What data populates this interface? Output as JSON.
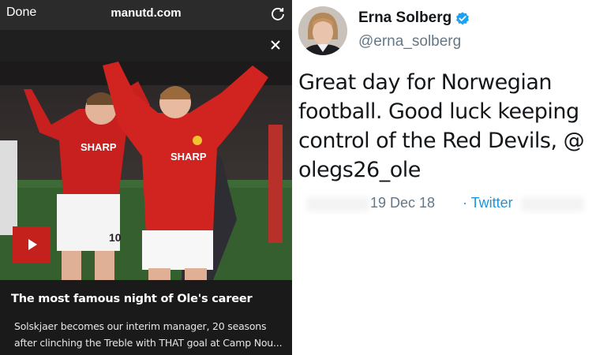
{
  "browser": {
    "done_label": "Done",
    "url": "manutd.com",
    "reload_icon": "reload-icon",
    "close_icon": "close-icon"
  },
  "article": {
    "play_icon": "play-icon",
    "title": "The most famous night of Ole's career",
    "summary_lines": [
      "Solskjaer becomes our interim manager, 20 seasons",
      "after clinching the Treble with THAT goal at Camp Nou..."
    ]
  },
  "tweet": {
    "display_name": "Erna Solberg",
    "verified_icon": "verified-badge-icon",
    "handle": "@erna_solberg",
    "text_lines": [
      "Great day for Norwegian",
      "football. Good luck keeping",
      "control of the Red Devils, @",
      "olegs26_ole"
    ],
    "date": "19 Dec 18",
    "source": "· Twitter"
  },
  "colors": {
    "accent_red": "#c4201c",
    "twitter_blue": "#1b95e0",
    "muted_gray": "#657786"
  }
}
